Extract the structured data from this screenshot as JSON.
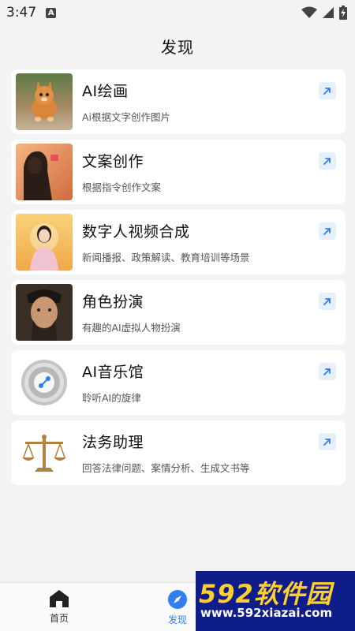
{
  "status": {
    "time": "3:47",
    "badge": "A"
  },
  "header": {
    "title": "发现"
  },
  "cards": [
    {
      "title": "AI绘画",
      "desc": "Ai根据文字创作图片",
      "thumb": "cat-image"
    },
    {
      "title": "文案创作",
      "desc": "根据指令创作文案",
      "thumb": "woman-sunset-image"
    },
    {
      "title": "数字人视频合成",
      "desc": "新闻播报、政策解读、教育培训等场景",
      "thumb": "presenter-image"
    },
    {
      "title": "角色扮演",
      "desc": "有趣的AI虚拟人物扮演",
      "thumb": "actor-image"
    },
    {
      "title": "AI音乐馆",
      "desc": "聆听AI的旋律",
      "thumb": "music-disc-icon"
    },
    {
      "title": "法务助理",
      "desc": "回答法律问题、案情分析、生成文书等",
      "thumb": "scales-icon"
    }
  ],
  "nav": {
    "home": "首页",
    "discover": "发现"
  },
  "watermark": {
    "main": "592软件园",
    "sub": "www.592xiazai.com"
  },
  "colors": {
    "accent": "#2f7ff0",
    "arrow_bg": "#e6f0fd",
    "card_bg": "#ffffff",
    "page_bg": "#f3f3f3"
  }
}
